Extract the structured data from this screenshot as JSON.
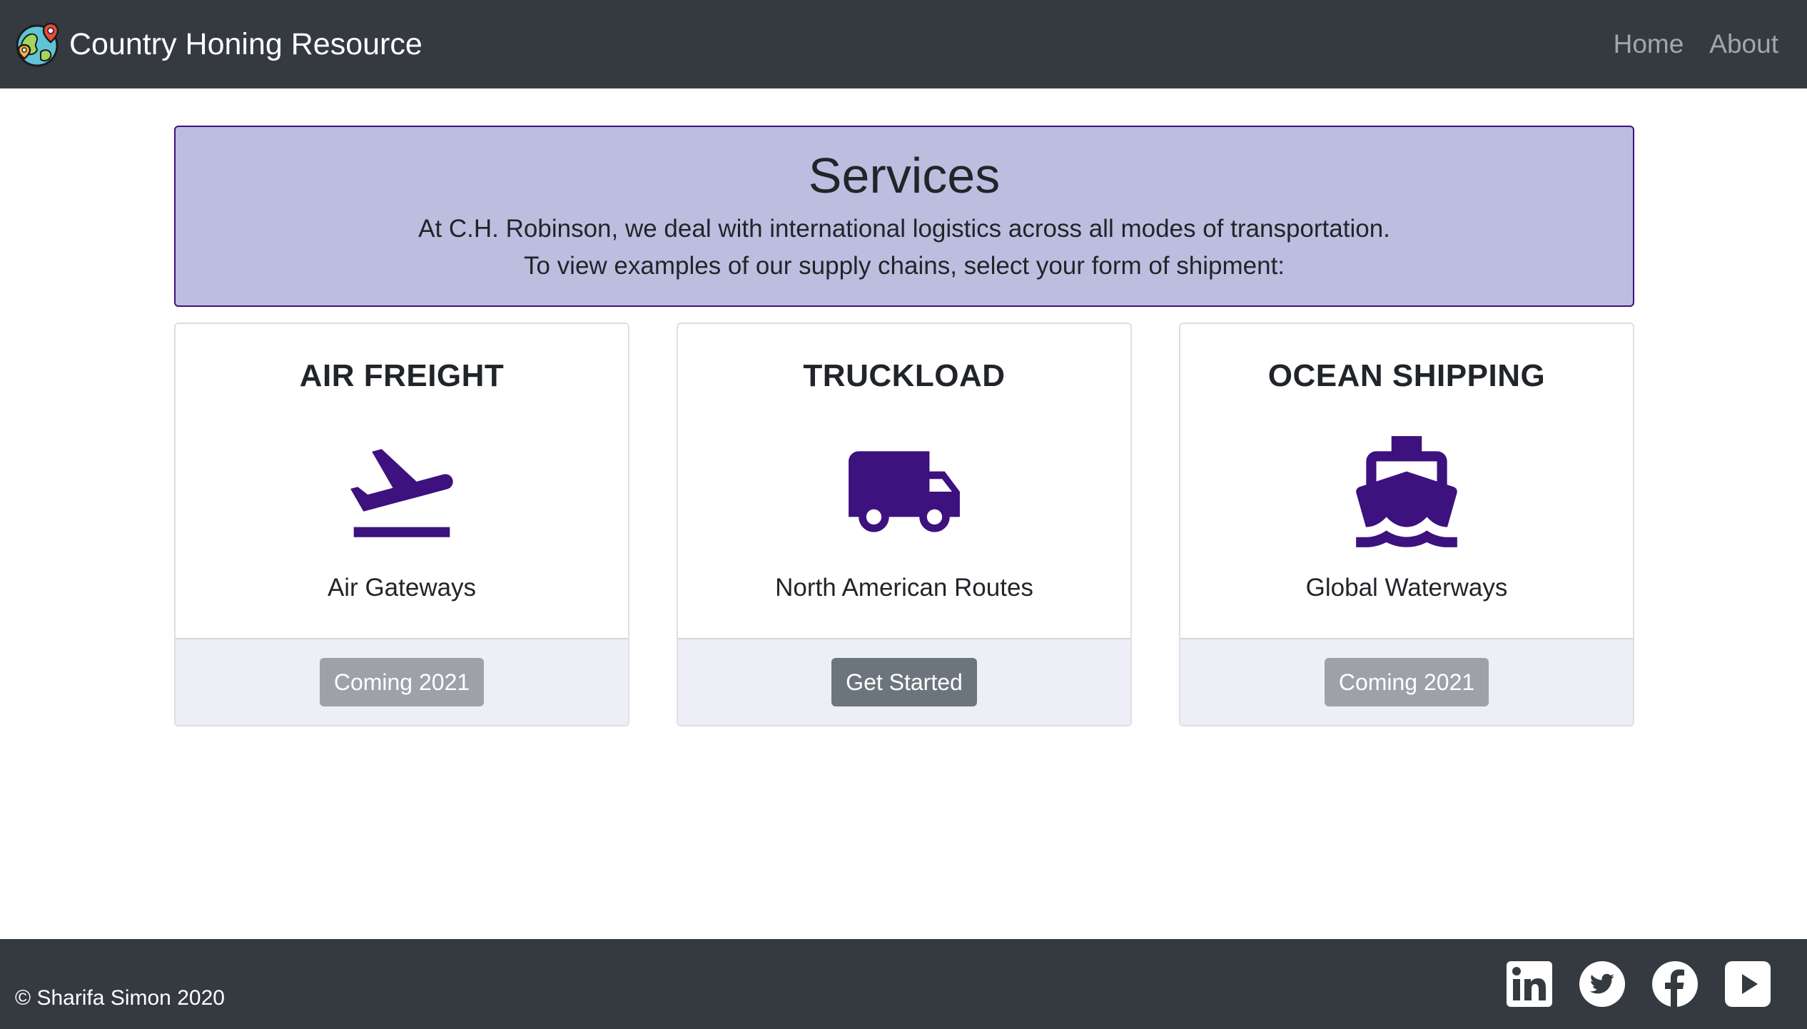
{
  "navbar": {
    "brand": "Country Honing Resource",
    "brand_icon": "globe-map-pin-icon",
    "links": [
      {
        "label": "Home"
      },
      {
        "label": "About"
      }
    ]
  },
  "jumbotron": {
    "title": "Services",
    "line1": "At C.H. Robinson, we deal with international logistics across all modes of transportation.",
    "line2": "To view examples of our supply chains, select your form of shipment:"
  },
  "cards": [
    {
      "title": "AIR FREIGHT",
      "icon": "airplane-takeoff-icon",
      "text": "Air Gateways",
      "button": "Coming 2021",
      "button_state": "disabled"
    },
    {
      "title": "TRUCKLOAD",
      "icon": "truck-icon",
      "text": "North American Routes",
      "button": "Get Started",
      "button_state": "active"
    },
    {
      "title": "OCEAN SHIPPING",
      "icon": "ship-icon",
      "text": "Global Waterways",
      "button": "Coming 2021",
      "button_state": "disabled"
    }
  ],
  "footer": {
    "copyright": "© Sharifa Simon 2020",
    "social": [
      "linkedin-icon",
      "twitter-icon",
      "facebook-icon",
      "youtube-icon"
    ]
  },
  "colors": {
    "navbar_bg": "#343a40",
    "jumbotron_bg": "#bcbedf",
    "accent_purple": "#3d117e",
    "card_footer_bg": "#eeeef7",
    "button_active": "#6c757d",
    "button_disabled": "#9ea1a8"
  }
}
